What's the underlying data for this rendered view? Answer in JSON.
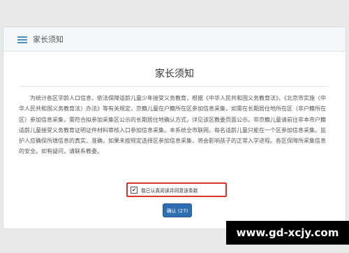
{
  "header": {
    "icon": "list-icon",
    "title": "家长须知"
  },
  "notice": {
    "title": "家长须知",
    "body": "为统计各区学龄人口信息，依法保障适龄儿童少年接受义务教育，根据《中华人民共和国义务教育法》、《北京市实施〈中华人民共和国义务教育法〉办法》等有关规定，京籍儿童在户籍所在区参加信息采集，如需在长期居住地所在区（非户籍所在区）参加信息采集，需符合拟参加采集区公示的长期居住地确认方式，详见该区教委页面公示。非京籍儿童请前往非本市户籍适龄儿童接受义务教育证明证件材料审核入口参加信息采集。本系统全市联网，每名适龄儿童只能在一个区参加信息采集。监护人应确保所填信息的真实、准确，如果未按规定选择区参加信息采集，将会影响孩子的正常入学进程。各区保障所采集信息的安全。如有疑问，请联系教委。"
  },
  "agree": {
    "checked": true,
    "check_mark": "✔",
    "label": "我已认真阅读并同意该条款",
    "highlight_color": "#d9342b"
  },
  "confirm_button": {
    "label": "确认 (27)",
    "color": "#2d6db0"
  },
  "watermark": {
    "text": "www.gd-xcjy.com"
  }
}
